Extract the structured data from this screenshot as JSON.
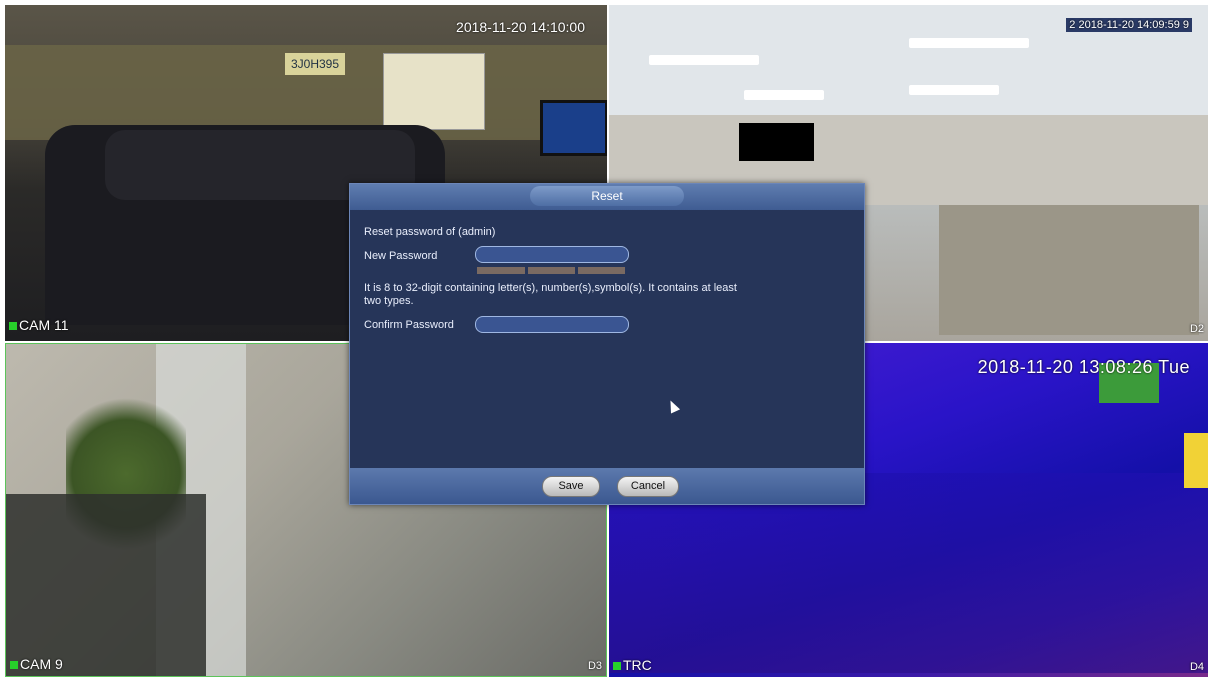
{
  "cameras": [
    {
      "id": "cam1",
      "label": "CAM 11",
      "timestamp": "2018-11-20 14:10:00",
      "sign_text": "3J0H395"
    },
    {
      "id": "cam2",
      "label": "D2",
      "timestamp": "2018-11-20 14:09:59",
      "timestamp_prefix": "2",
      "timestamp_suffix": "9"
    },
    {
      "id": "cam3",
      "label": "CAM 9",
      "corner_label": "D3"
    },
    {
      "id": "cam4",
      "label": "TRC",
      "timestamp": "2018-11-20 13:08:26 Tue",
      "corner_label": "D4"
    }
  ],
  "dialog": {
    "title": "Reset",
    "reset_of": "Reset password of (admin)",
    "new_password_label": "New Password",
    "new_password_value": "",
    "hint": "It is 8 to 32-digit containing letter(s), number(s),symbol(s). It contains at least two types.",
    "confirm_password_label": "Confirm Password",
    "confirm_password_value": "",
    "save_label": "Save",
    "cancel_label": "Cancel"
  },
  "colors": {
    "dialog_bg": "#263559",
    "dialog_header": "#3f5c92",
    "camera_active_border": "#5cc35a",
    "record_indicator": "#27d02a"
  }
}
